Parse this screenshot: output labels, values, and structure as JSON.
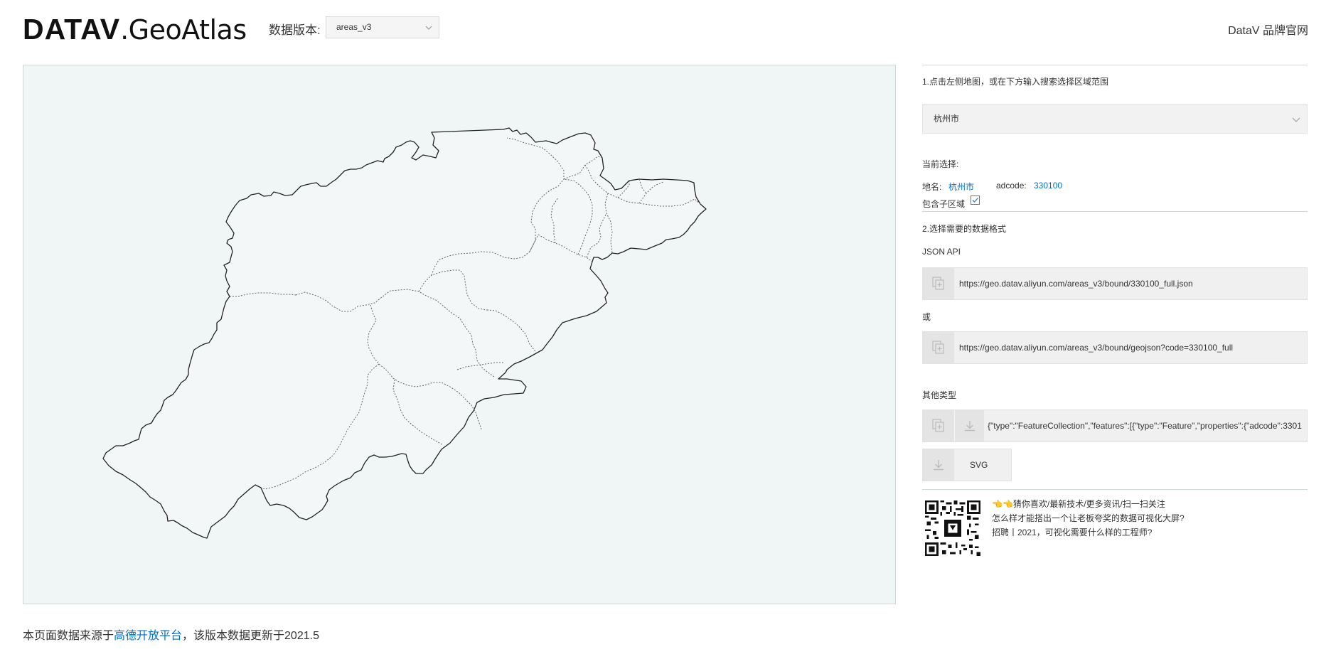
{
  "header": {
    "logo_bold": "DATAV",
    "logo_light": ".GeoAtlas",
    "version_label": "数据版本:",
    "version_value": "areas_v3",
    "brand_link": "DataV 品牌官网"
  },
  "side": {
    "step1": "1.点击左侧地图，或在下方输入搜索选择区域范围",
    "region_value": "杭州市",
    "current_label": "当前选择:",
    "name_label": "地名:",
    "name_value": "杭州市",
    "adcode_label": "adcode:",
    "adcode_value": "330100",
    "include_sub_label": "包含子区域",
    "include_sub_checked": true,
    "step2": "2.选择需要的数据格式",
    "json_api_label": "JSON API",
    "url1": "https://geo.datav.aliyun.com/areas_v3/bound/330100_full.json",
    "or_label": "或",
    "url2": "https://geo.datav.aliyun.com/areas_v3/bound/geojson?code=330100_full",
    "other_label": "其他类型",
    "geojson_preview": "{\"type\":\"FeatureCollection\",\"features\":[{\"type\":\"Feature\",\"properties\":{\"adcode\":3301",
    "svg_label": "SVG",
    "promo": [
      "👈👈猜你喜欢/最新技术/更多资讯/扫一扫关注",
      "怎么样才能搭出一个让老板夸奖的数据可视化大屏?",
      "招聘丨2021，可视化需要什么样的工程师?"
    ]
  },
  "footer": {
    "prefix": "本页面数据来源于",
    "link": "高德开放平台",
    "suffix": "，该版本数据更新于2021.5"
  },
  "colors": {
    "accent": "#0070cc",
    "map_bg": "#f0f5f5",
    "region_fill": "#f4f7f7",
    "border": "#cfd8d8"
  },
  "icons": [
    "chevron-down-icon",
    "copy-icon",
    "download-icon",
    "checkbox-icon",
    "qr-code-icon"
  ]
}
